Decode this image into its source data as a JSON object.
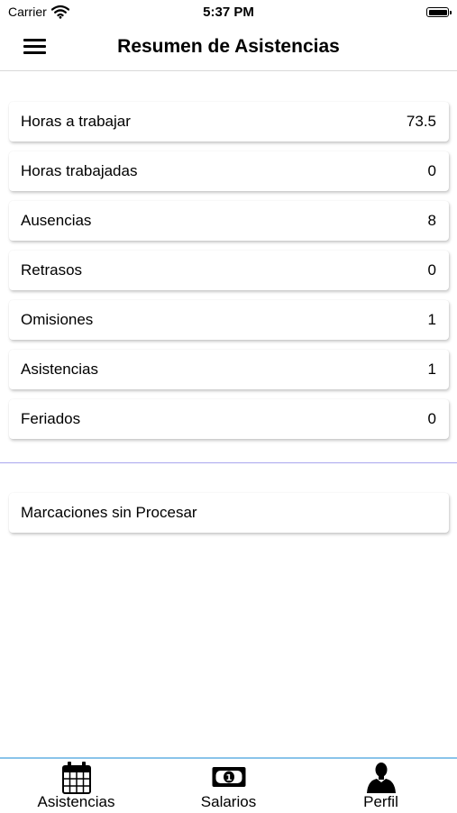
{
  "status_bar": {
    "carrier": "Carrier",
    "time": "5:37 PM"
  },
  "nav": {
    "title": "Resumen de Asistencias"
  },
  "summary": [
    {
      "label": "Horas a trabajar",
      "value": "73.5"
    },
    {
      "label": "Horas trabajadas",
      "value": "0"
    },
    {
      "label": "Ausencias",
      "value": "8"
    },
    {
      "label": "Retrasos",
      "value": "0"
    },
    {
      "label": "Omisiones",
      "value": "1"
    },
    {
      "label": "Asistencias",
      "value": "1"
    },
    {
      "label": "Feriados",
      "value": "0"
    }
  ],
  "unprocessed": {
    "label": "Marcaciones sin Procesar"
  },
  "tabs": [
    {
      "label": "Asistencias",
      "icon": "calendar-icon"
    },
    {
      "label": "Salarios",
      "icon": "banknote-icon"
    },
    {
      "label": "Perfil",
      "icon": "user-icon"
    }
  ],
  "colors": {
    "divider": "#a9a6ee",
    "tab_bar_border": "#89c4ea"
  }
}
